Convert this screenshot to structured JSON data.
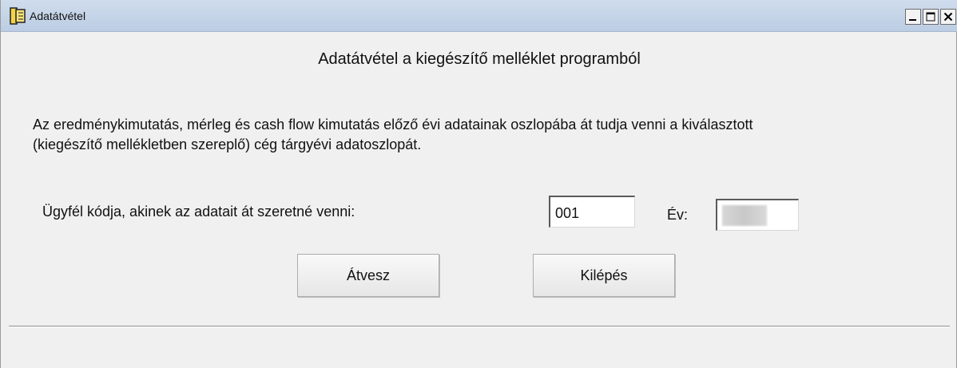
{
  "window": {
    "title": "Adatátvétel",
    "controls": {
      "minimize": "minimize-icon",
      "maximize": "maximize-icon",
      "close": "close-icon"
    }
  },
  "main": {
    "heading": "Adatátvétel a kiegészítő melléklet programból",
    "description_line1": "Az eredménykimutatás, mérleg és cash flow kimutatás előző évi adatainak oszlopába át tudja venni a kiválasztott",
    "description_line2": "(kiegészítő mellékletben szereplő) cég tárgyévi adatoszlopát.",
    "client_code_label": "Ügyfél kódja, akinek az adatait át szeretné venni:",
    "client_code_value": "001",
    "year_label": "Év:",
    "buttons": {
      "take_over": "Átvesz",
      "exit": "Kilépés"
    }
  },
  "colors": {
    "titlebar": "#c4d3e8",
    "window_bg": "#f0f0f0",
    "text": "#111111"
  }
}
